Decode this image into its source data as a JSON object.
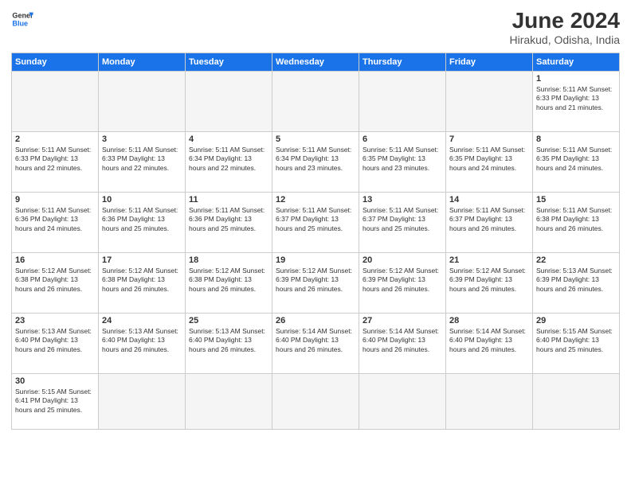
{
  "header": {
    "logo_line1": "General",
    "logo_line2": "Blue",
    "title": "June 2024",
    "subtitle": "Hirakud, Odisha, India"
  },
  "days_of_week": [
    "Sunday",
    "Monday",
    "Tuesday",
    "Wednesday",
    "Thursday",
    "Friday",
    "Saturday"
  ],
  "weeks": [
    [
      {
        "num": "",
        "info": ""
      },
      {
        "num": "",
        "info": ""
      },
      {
        "num": "",
        "info": ""
      },
      {
        "num": "",
        "info": ""
      },
      {
        "num": "",
        "info": ""
      },
      {
        "num": "",
        "info": ""
      },
      {
        "num": "1",
        "info": "Sunrise: 5:11 AM\nSunset: 6:33 PM\nDaylight: 13 hours\nand 21 minutes."
      }
    ],
    [
      {
        "num": "2",
        "info": "Sunrise: 5:11 AM\nSunset: 6:33 PM\nDaylight: 13 hours\nand 22 minutes."
      },
      {
        "num": "3",
        "info": "Sunrise: 5:11 AM\nSunset: 6:33 PM\nDaylight: 13 hours\nand 22 minutes."
      },
      {
        "num": "4",
        "info": "Sunrise: 5:11 AM\nSunset: 6:34 PM\nDaylight: 13 hours\nand 22 minutes."
      },
      {
        "num": "5",
        "info": "Sunrise: 5:11 AM\nSunset: 6:34 PM\nDaylight: 13 hours\nand 23 minutes."
      },
      {
        "num": "6",
        "info": "Sunrise: 5:11 AM\nSunset: 6:35 PM\nDaylight: 13 hours\nand 23 minutes."
      },
      {
        "num": "7",
        "info": "Sunrise: 5:11 AM\nSunset: 6:35 PM\nDaylight: 13 hours\nand 24 minutes."
      },
      {
        "num": "8",
        "info": "Sunrise: 5:11 AM\nSunset: 6:35 PM\nDaylight: 13 hours\nand 24 minutes."
      }
    ],
    [
      {
        "num": "9",
        "info": "Sunrise: 5:11 AM\nSunset: 6:36 PM\nDaylight: 13 hours\nand 24 minutes."
      },
      {
        "num": "10",
        "info": "Sunrise: 5:11 AM\nSunset: 6:36 PM\nDaylight: 13 hours\nand 25 minutes."
      },
      {
        "num": "11",
        "info": "Sunrise: 5:11 AM\nSunset: 6:36 PM\nDaylight: 13 hours\nand 25 minutes."
      },
      {
        "num": "12",
        "info": "Sunrise: 5:11 AM\nSunset: 6:37 PM\nDaylight: 13 hours\nand 25 minutes."
      },
      {
        "num": "13",
        "info": "Sunrise: 5:11 AM\nSunset: 6:37 PM\nDaylight: 13 hours\nand 25 minutes."
      },
      {
        "num": "14",
        "info": "Sunrise: 5:11 AM\nSunset: 6:37 PM\nDaylight: 13 hours\nand 26 minutes."
      },
      {
        "num": "15",
        "info": "Sunrise: 5:11 AM\nSunset: 6:38 PM\nDaylight: 13 hours\nand 26 minutes."
      }
    ],
    [
      {
        "num": "16",
        "info": "Sunrise: 5:12 AM\nSunset: 6:38 PM\nDaylight: 13 hours\nand 26 minutes."
      },
      {
        "num": "17",
        "info": "Sunrise: 5:12 AM\nSunset: 6:38 PM\nDaylight: 13 hours\nand 26 minutes."
      },
      {
        "num": "18",
        "info": "Sunrise: 5:12 AM\nSunset: 6:38 PM\nDaylight: 13 hours\nand 26 minutes."
      },
      {
        "num": "19",
        "info": "Sunrise: 5:12 AM\nSunset: 6:39 PM\nDaylight: 13 hours\nand 26 minutes."
      },
      {
        "num": "20",
        "info": "Sunrise: 5:12 AM\nSunset: 6:39 PM\nDaylight: 13 hours\nand 26 minutes."
      },
      {
        "num": "21",
        "info": "Sunrise: 5:12 AM\nSunset: 6:39 PM\nDaylight: 13 hours\nand 26 minutes."
      },
      {
        "num": "22",
        "info": "Sunrise: 5:13 AM\nSunset: 6:39 PM\nDaylight: 13 hours\nand 26 minutes."
      }
    ],
    [
      {
        "num": "23",
        "info": "Sunrise: 5:13 AM\nSunset: 6:40 PM\nDaylight: 13 hours\nand 26 minutes."
      },
      {
        "num": "24",
        "info": "Sunrise: 5:13 AM\nSunset: 6:40 PM\nDaylight: 13 hours\nand 26 minutes."
      },
      {
        "num": "25",
        "info": "Sunrise: 5:13 AM\nSunset: 6:40 PM\nDaylight: 13 hours\nand 26 minutes."
      },
      {
        "num": "26",
        "info": "Sunrise: 5:14 AM\nSunset: 6:40 PM\nDaylight: 13 hours\nand 26 minutes."
      },
      {
        "num": "27",
        "info": "Sunrise: 5:14 AM\nSunset: 6:40 PM\nDaylight: 13 hours\nand 26 minutes."
      },
      {
        "num": "28",
        "info": "Sunrise: 5:14 AM\nSunset: 6:40 PM\nDaylight: 13 hours\nand 26 minutes."
      },
      {
        "num": "29",
        "info": "Sunrise: 5:15 AM\nSunset: 6:40 PM\nDaylight: 13 hours\nand 25 minutes."
      }
    ],
    [
      {
        "num": "30",
        "info": "Sunrise: 5:15 AM\nSunset: 6:41 PM\nDaylight: 13 hours\nand 25 minutes."
      },
      {
        "num": "",
        "info": ""
      },
      {
        "num": "",
        "info": ""
      },
      {
        "num": "",
        "info": ""
      },
      {
        "num": "",
        "info": ""
      },
      {
        "num": "",
        "info": ""
      },
      {
        "num": "",
        "info": ""
      }
    ]
  ]
}
